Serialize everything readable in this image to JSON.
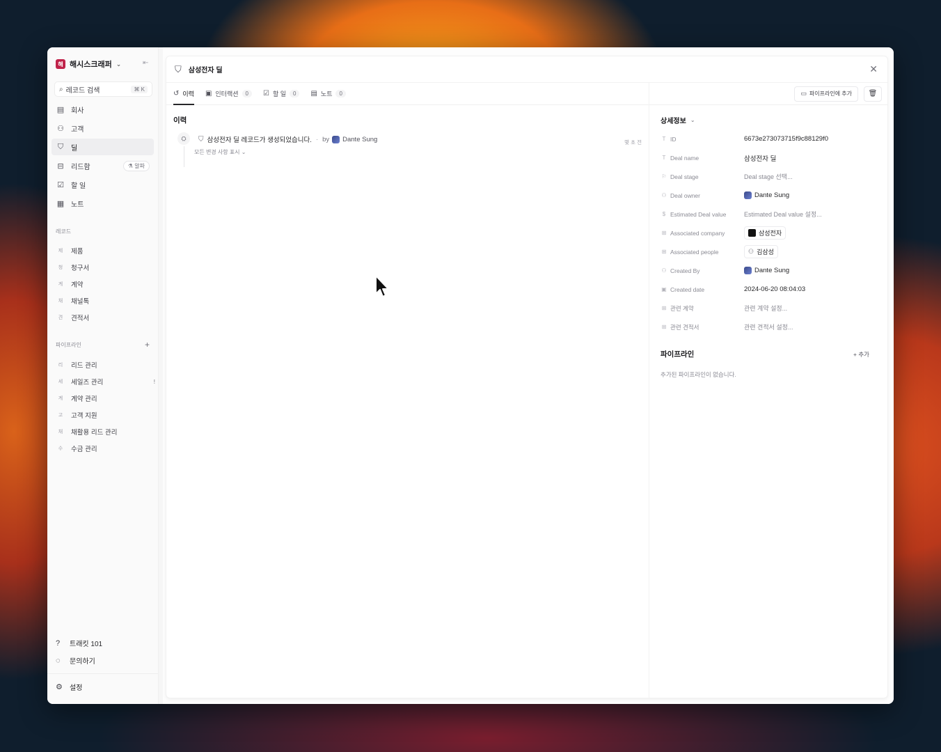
{
  "workspace": {
    "logo_letter": "해",
    "name": "해시스크래퍼"
  },
  "search": {
    "label": "레코드 검색",
    "shortcut": "⌘ K"
  },
  "nav": [
    {
      "label": "회사",
      "icon": "building-icon"
    },
    {
      "label": "고객",
      "icon": "person-icon"
    },
    {
      "label": "딜",
      "icon": "handshake-icon",
      "active": true
    },
    {
      "label": "리드함",
      "icon": "inbox-icon",
      "badge": "알파"
    },
    {
      "label": "할 일",
      "icon": "checklist-icon"
    },
    {
      "label": "노트",
      "icon": "note-icon"
    }
  ],
  "records": {
    "label": "레코드",
    "items": [
      {
        "mini": "제",
        "label": "제품"
      },
      {
        "mini": "청",
        "label": "청구서"
      },
      {
        "mini": "계",
        "label": "계약"
      },
      {
        "mini": "채",
        "label": "채널톡"
      },
      {
        "mini": "견",
        "label": "견적서"
      }
    ]
  },
  "pipelines": {
    "label": "파이프라인",
    "items": [
      {
        "mini": "리",
        "label": "리드 관리"
      },
      {
        "mini": "세",
        "label": "세일즈 관리",
        "indicator": "!"
      },
      {
        "mini": "계",
        "label": "계약 관리"
      },
      {
        "mini": "고",
        "label": "고객 지원"
      },
      {
        "mini": "채",
        "label": "채활용 리드 관리"
      },
      {
        "mini": "수",
        "label": "수금 관리"
      }
    ]
  },
  "bottom": {
    "guide": "트래킷 101",
    "contact": "문의하기",
    "settings": "설정"
  },
  "record": {
    "title": "삼성전자 딜"
  },
  "tabs": [
    {
      "label": "이력",
      "count": null,
      "active": true
    },
    {
      "label": "인터랙션",
      "count": "0"
    },
    {
      "label": "할 일",
      "count": "0"
    },
    {
      "label": "노트",
      "count": "0"
    }
  ],
  "history": {
    "title": "이력",
    "entry": {
      "text": "삼성전자 딜 레코드가 생성되었습니다.",
      "by": "by",
      "user": "Dante Sung",
      "time": "몇 초 전",
      "more": "모든 변경 사항 표시"
    }
  },
  "toolbar": {
    "add_pipeline": "파이프라인에 추가"
  },
  "details": {
    "title": "상세정보",
    "fields": [
      {
        "label": "ID",
        "value": "6673e273073715f9c88129f0"
      },
      {
        "label": "Deal name",
        "value": "삼성전자 딜"
      },
      {
        "label": "Deal stage",
        "value": "Deal stage 선택..."
      },
      {
        "label": "Deal owner",
        "value": "Dante Sung"
      },
      {
        "label": "Estimated Deal value",
        "value": "Estimated Deal value 설정..."
      },
      {
        "label": "Associated company",
        "value": "삼성전자"
      },
      {
        "label": "Associated people",
        "value": "김삼성"
      },
      {
        "label": "Created By",
        "value": "Dante Sung"
      },
      {
        "label": "Created date",
        "value": "2024-06-20 08:04:03"
      },
      {
        "label": "관련 계약",
        "value": "관련 계약 설정..."
      },
      {
        "label": "관련 견적서",
        "value": "관련 견적서 설정..."
      }
    ]
  },
  "pipeline_panel": {
    "title": "파이프라인",
    "add": "+ 추가",
    "empty": "추가된 파이프라인이 없습니다."
  }
}
